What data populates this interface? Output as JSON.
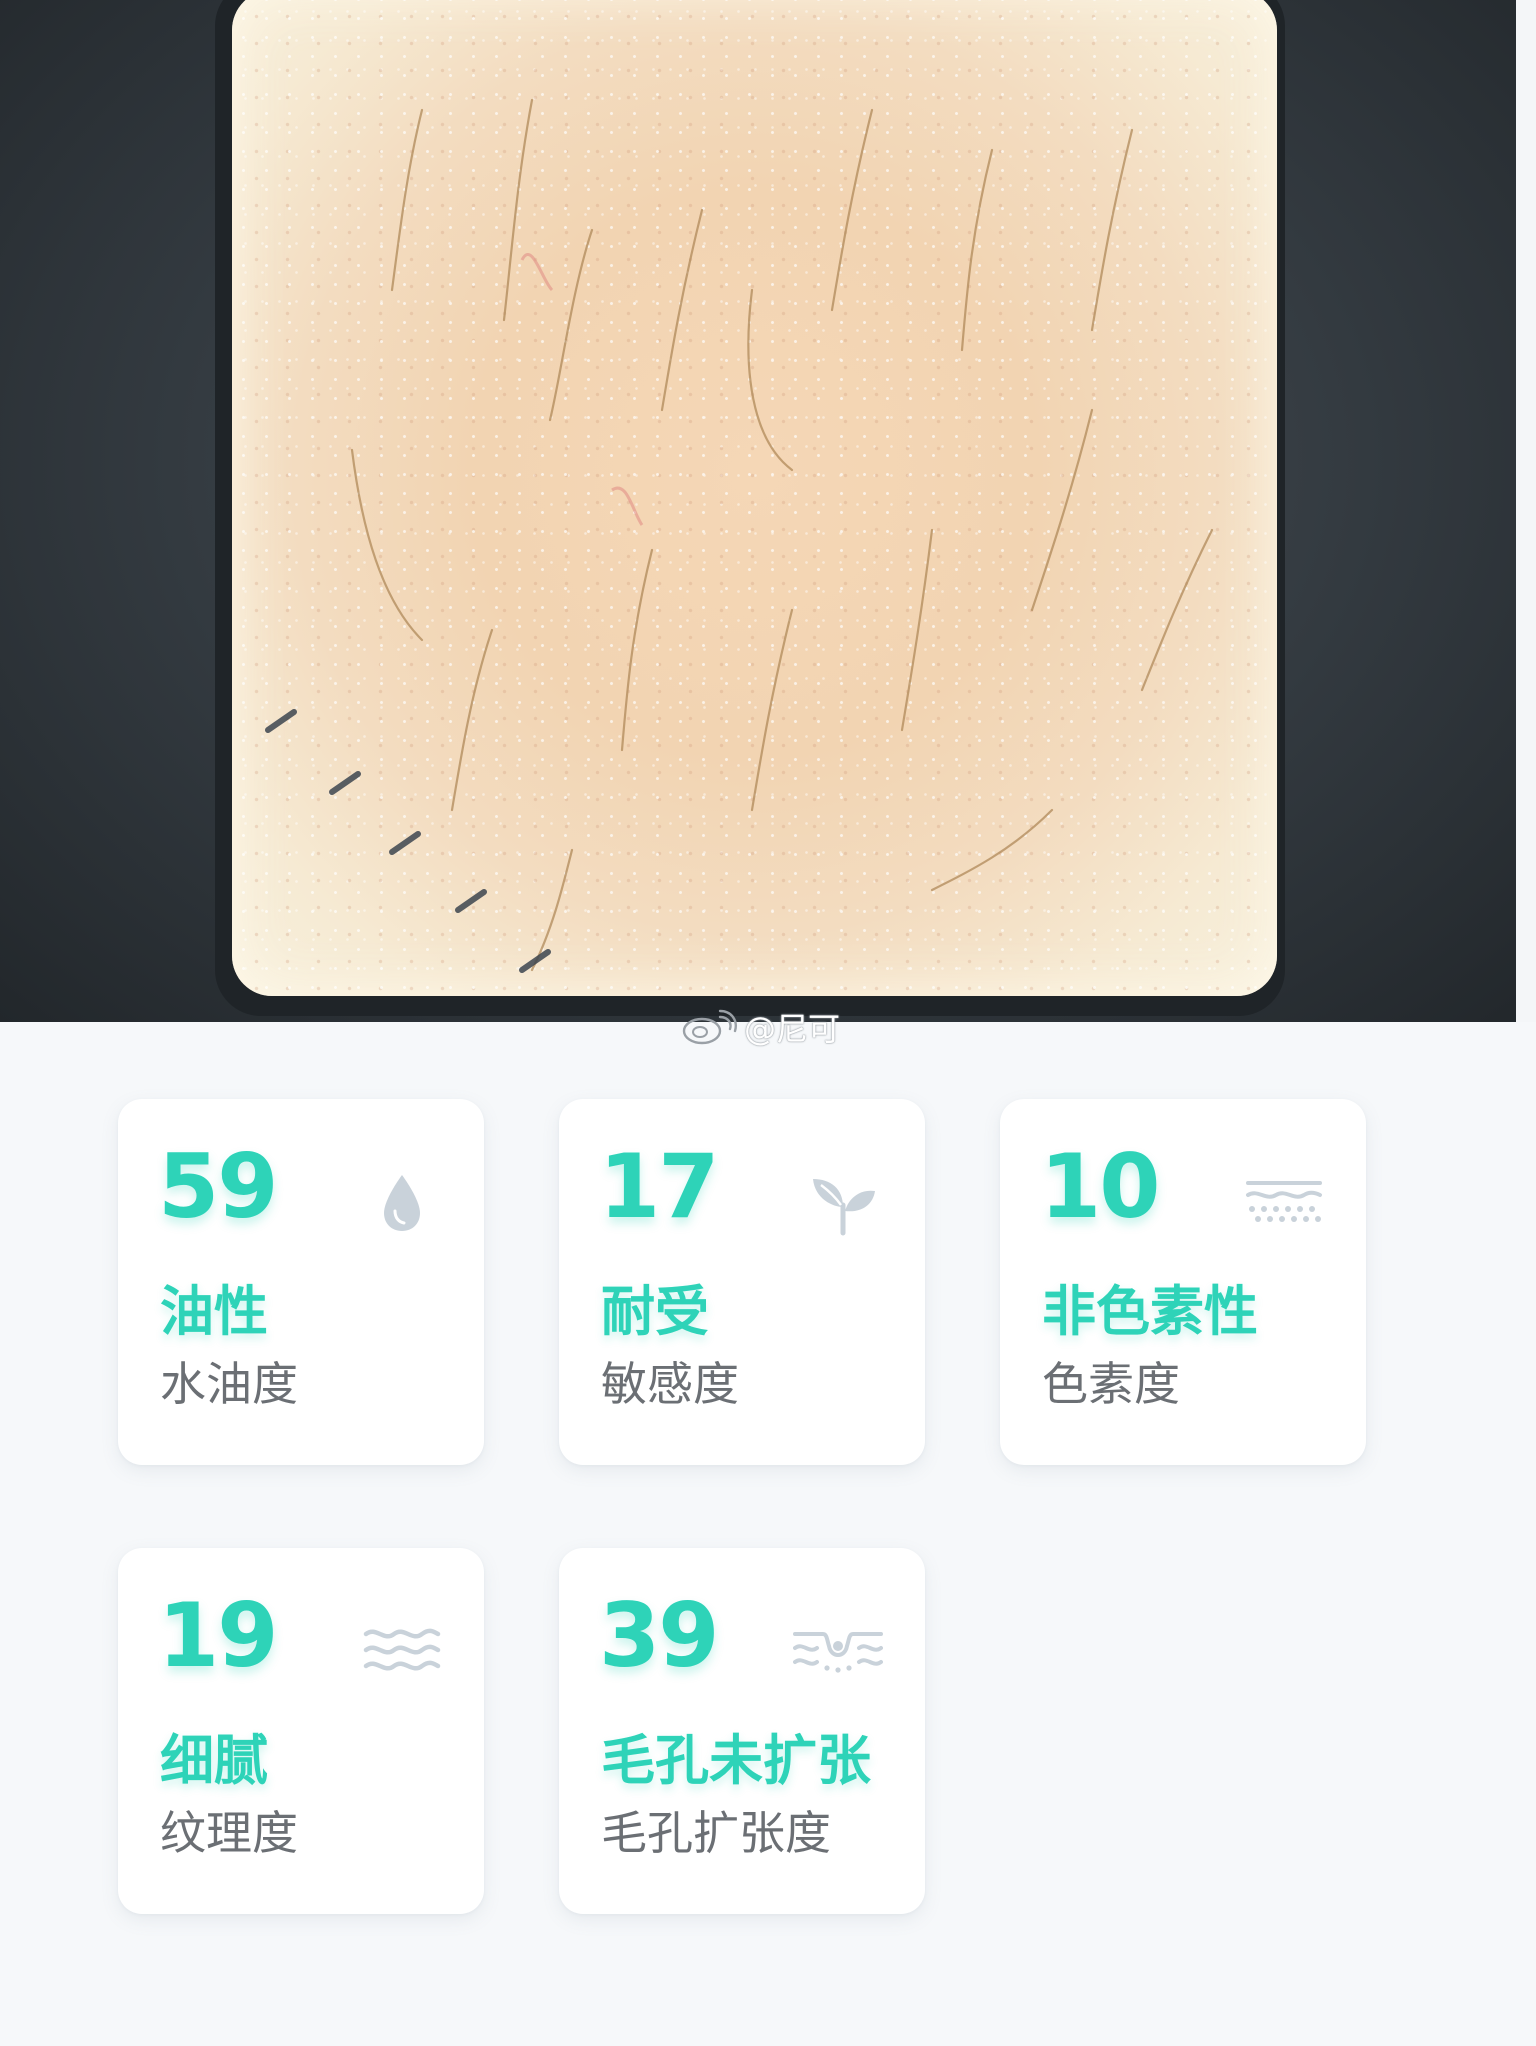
{
  "watermark": {
    "icon": "weibo-icon",
    "text": "@尼可"
  },
  "colors": {
    "accent": "#2ed3b8",
    "label": "#6b6f74",
    "icon": "#c9d2da",
    "card_bg": "#ffffff",
    "page_bg": "#f6f8fa"
  },
  "metrics": [
    {
      "score": "59",
      "level": "油性",
      "name": "水油度",
      "icon": "water-drop-icon"
    },
    {
      "score": "17",
      "level": "耐受",
      "name": "敏感度",
      "icon": "leaf-sprout-icon"
    },
    {
      "score": "10",
      "level": "非色素性",
      "name": "色素度",
      "icon": "pigment-layers-icon"
    },
    {
      "score": "19",
      "level": "细腻",
      "name": "纹理度",
      "icon": "texture-waves-icon"
    },
    {
      "score": "39",
      "level": "毛孔未扩张",
      "name": "毛孔扩张度",
      "icon": "pore-icon"
    }
  ]
}
